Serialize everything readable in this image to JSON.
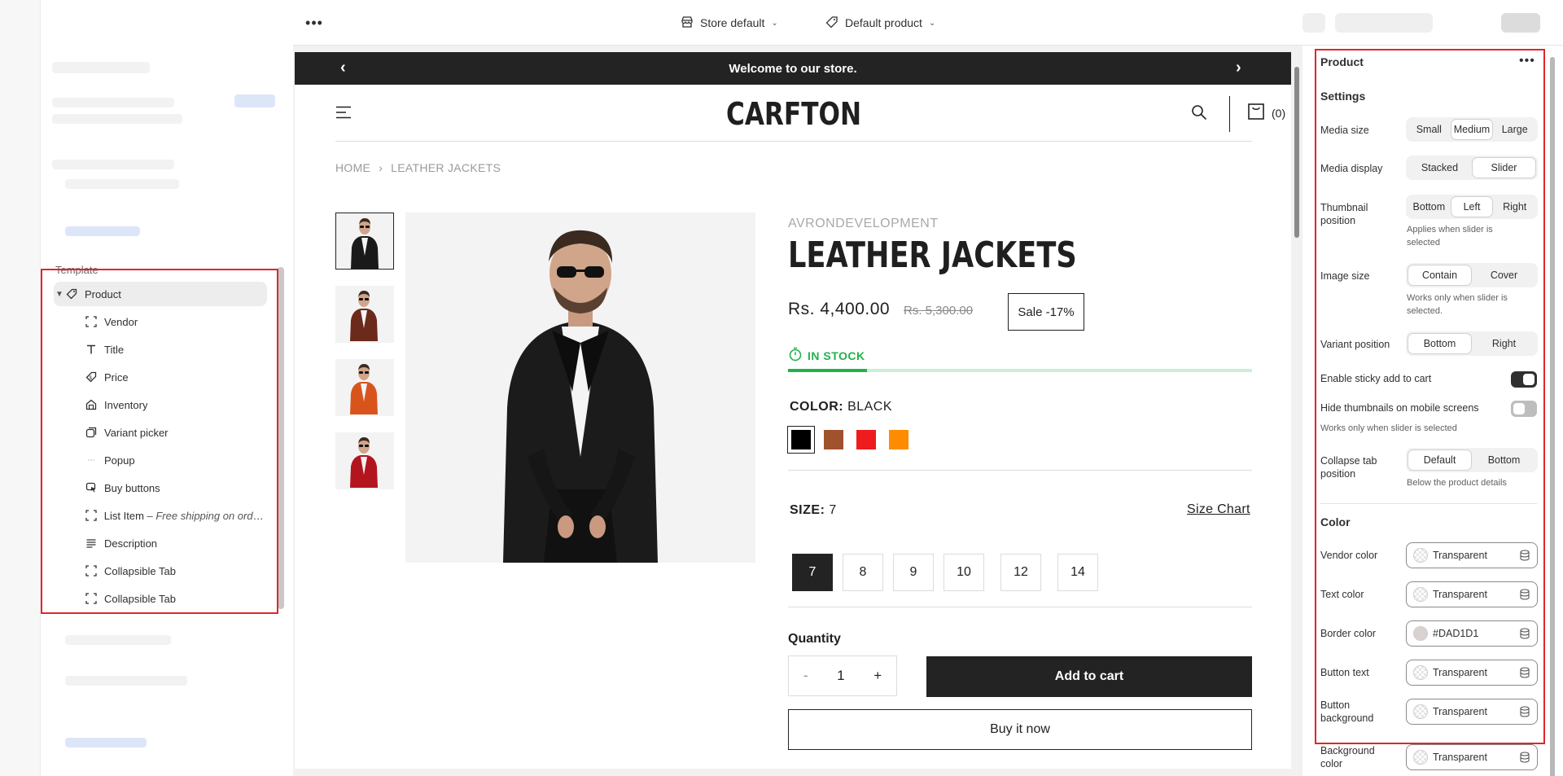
{
  "sidebar": {
    "template_label": "Template",
    "tree": {
      "root": "Product",
      "children": [
        {
          "label": "Vendor",
          "icon": "section-bracket-icon"
        },
        {
          "label": "Title",
          "icon": "text-icon"
        },
        {
          "label": "Price",
          "icon": "price-tag-icon"
        },
        {
          "label": "Inventory",
          "icon": "inventory-icon"
        },
        {
          "label": "Variant picker",
          "icon": "variant-icon"
        },
        {
          "label": "Popup",
          "icon": "popup-icon"
        },
        {
          "label": "Buy buttons",
          "icon": "cursor-click-icon"
        },
        {
          "label": "List Item",
          "suffix": " – Free shipping on orde…",
          "icon": "section-bracket-icon"
        },
        {
          "label": "Description",
          "icon": "lines-icon"
        },
        {
          "label": "Collapsible Tab",
          "icon": "section-bracket-icon"
        },
        {
          "label": "Collapsible Tab",
          "icon": "section-bracket-icon"
        }
      ]
    }
  },
  "topbar": {
    "store_selector": "Store default",
    "template_selector": "Default product"
  },
  "preview": {
    "announcement": "Welcome to our store.",
    "logo": "CARFTON",
    "cart_count": "(0)",
    "breadcrumb": [
      "HOME",
      "LEATHER JACKETS"
    ],
    "vendor": "AVRONDEVELOPMENT",
    "title": "LEATHER JACKETS",
    "price": "Rs. 4,400.00",
    "compare_price": "Rs. 5,300.00",
    "sale_badge": "Sale -17%",
    "stock": {
      "text": "IN STOCK",
      "fill_fraction": 0.17
    },
    "color": {
      "label": "COLOR:",
      "value": "BLACK",
      "swatches": [
        "#000000",
        "#a0522d",
        "#ee1c1c",
        "#ff8c00"
      ],
      "selected": 0
    },
    "size": {
      "label": "SIZE:",
      "value": "7",
      "chart_link": "Size Chart",
      "options": [
        "7",
        "8",
        "9",
        "10",
        "12",
        "14"
      ],
      "selected": 0
    },
    "quantity": {
      "label": "Quantity",
      "minus": "-",
      "value": "1",
      "plus": "+"
    },
    "add_to_cart": "Add to cart",
    "buy_now": "Buy it now",
    "thumb_colors": [
      "#1a1a1a",
      "#6b2a1c",
      "#d9541c",
      "#b3151e"
    ]
  },
  "panel": {
    "title": "Product",
    "settings_heading": "Settings",
    "media_size": {
      "label": "Media size",
      "options": [
        "Small",
        "Medium",
        "Large"
      ],
      "active": 1
    },
    "media_display": {
      "label": "Media display",
      "options": [
        "Stacked",
        "Slider"
      ],
      "active": 1
    },
    "thumbnail_position": {
      "label": "Thumbnail position",
      "options": [
        "Bottom",
        "Left",
        "Right"
      ],
      "active": 1,
      "hint": "Applies when slider is selected"
    },
    "image_size": {
      "label": "Image size",
      "options": [
        "Contain",
        "Cover"
      ],
      "active": 0,
      "hint": "Works only when slider is selected."
    },
    "variant_position": {
      "label": "Variant position",
      "options": [
        "Bottom",
        "Right"
      ],
      "active": 0
    },
    "sticky_cart": {
      "label": "Enable sticky add to cart",
      "on": true
    },
    "hide_thumbs": {
      "label": "Hide thumbnails on mobile screens",
      "on": false,
      "hint": "Works only when slider is selected"
    },
    "collapse_tab": {
      "label": "Collapse tab position",
      "options": [
        "Default",
        "Bottom"
      ],
      "active": 0,
      "hint": "Below the product details"
    },
    "color_heading": "Color",
    "colors": [
      {
        "label": "Vendor color",
        "value": "Transparent",
        "swatch": "transparent"
      },
      {
        "label": "Text color",
        "value": "Transparent",
        "swatch": "transparent"
      },
      {
        "label": "Border color",
        "value": "#DAD1D1",
        "swatch": "#DAD1D1"
      },
      {
        "label": "Button text",
        "value": "Transparent",
        "swatch": "transparent"
      },
      {
        "label": "Button background",
        "value": "Transparent",
        "swatch": "transparent"
      },
      {
        "label": "Background color",
        "value": "Transparent",
        "swatch": "transparent"
      }
    ]
  },
  "colors": {
    "accent_red": "#e0262b",
    "dark": "#232323",
    "stock_green": "#22b24c"
  }
}
